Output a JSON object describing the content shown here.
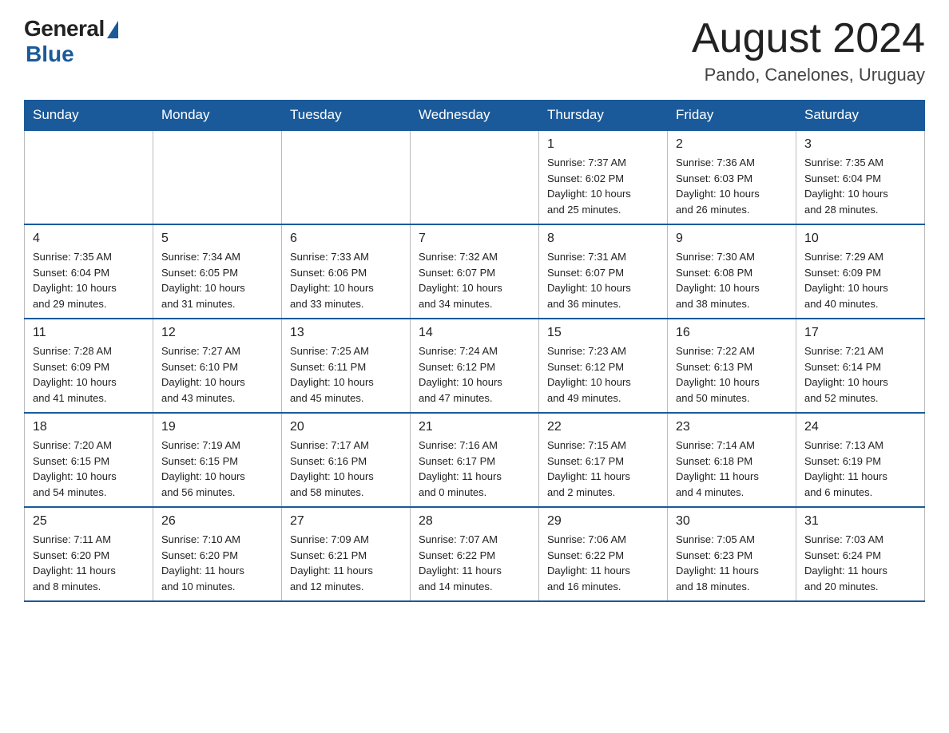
{
  "logo": {
    "general": "General",
    "blue": "Blue"
  },
  "header": {
    "title": "August 2024",
    "location": "Pando, Canelones, Uruguay"
  },
  "weekdays": [
    "Sunday",
    "Monday",
    "Tuesday",
    "Wednesday",
    "Thursday",
    "Friday",
    "Saturday"
  ],
  "weeks": [
    [
      {
        "day": "",
        "info": ""
      },
      {
        "day": "",
        "info": ""
      },
      {
        "day": "",
        "info": ""
      },
      {
        "day": "",
        "info": ""
      },
      {
        "day": "1",
        "info": "Sunrise: 7:37 AM\nSunset: 6:02 PM\nDaylight: 10 hours\nand 25 minutes."
      },
      {
        "day": "2",
        "info": "Sunrise: 7:36 AM\nSunset: 6:03 PM\nDaylight: 10 hours\nand 26 minutes."
      },
      {
        "day": "3",
        "info": "Sunrise: 7:35 AM\nSunset: 6:04 PM\nDaylight: 10 hours\nand 28 minutes."
      }
    ],
    [
      {
        "day": "4",
        "info": "Sunrise: 7:35 AM\nSunset: 6:04 PM\nDaylight: 10 hours\nand 29 minutes."
      },
      {
        "day": "5",
        "info": "Sunrise: 7:34 AM\nSunset: 6:05 PM\nDaylight: 10 hours\nand 31 minutes."
      },
      {
        "day": "6",
        "info": "Sunrise: 7:33 AM\nSunset: 6:06 PM\nDaylight: 10 hours\nand 33 minutes."
      },
      {
        "day": "7",
        "info": "Sunrise: 7:32 AM\nSunset: 6:07 PM\nDaylight: 10 hours\nand 34 minutes."
      },
      {
        "day": "8",
        "info": "Sunrise: 7:31 AM\nSunset: 6:07 PM\nDaylight: 10 hours\nand 36 minutes."
      },
      {
        "day": "9",
        "info": "Sunrise: 7:30 AM\nSunset: 6:08 PM\nDaylight: 10 hours\nand 38 minutes."
      },
      {
        "day": "10",
        "info": "Sunrise: 7:29 AM\nSunset: 6:09 PM\nDaylight: 10 hours\nand 40 minutes."
      }
    ],
    [
      {
        "day": "11",
        "info": "Sunrise: 7:28 AM\nSunset: 6:09 PM\nDaylight: 10 hours\nand 41 minutes."
      },
      {
        "day": "12",
        "info": "Sunrise: 7:27 AM\nSunset: 6:10 PM\nDaylight: 10 hours\nand 43 minutes."
      },
      {
        "day": "13",
        "info": "Sunrise: 7:25 AM\nSunset: 6:11 PM\nDaylight: 10 hours\nand 45 minutes."
      },
      {
        "day": "14",
        "info": "Sunrise: 7:24 AM\nSunset: 6:12 PM\nDaylight: 10 hours\nand 47 minutes."
      },
      {
        "day": "15",
        "info": "Sunrise: 7:23 AM\nSunset: 6:12 PM\nDaylight: 10 hours\nand 49 minutes."
      },
      {
        "day": "16",
        "info": "Sunrise: 7:22 AM\nSunset: 6:13 PM\nDaylight: 10 hours\nand 50 minutes."
      },
      {
        "day": "17",
        "info": "Sunrise: 7:21 AM\nSunset: 6:14 PM\nDaylight: 10 hours\nand 52 minutes."
      }
    ],
    [
      {
        "day": "18",
        "info": "Sunrise: 7:20 AM\nSunset: 6:15 PM\nDaylight: 10 hours\nand 54 minutes."
      },
      {
        "day": "19",
        "info": "Sunrise: 7:19 AM\nSunset: 6:15 PM\nDaylight: 10 hours\nand 56 minutes."
      },
      {
        "day": "20",
        "info": "Sunrise: 7:17 AM\nSunset: 6:16 PM\nDaylight: 10 hours\nand 58 minutes."
      },
      {
        "day": "21",
        "info": "Sunrise: 7:16 AM\nSunset: 6:17 PM\nDaylight: 11 hours\nand 0 minutes."
      },
      {
        "day": "22",
        "info": "Sunrise: 7:15 AM\nSunset: 6:17 PM\nDaylight: 11 hours\nand 2 minutes."
      },
      {
        "day": "23",
        "info": "Sunrise: 7:14 AM\nSunset: 6:18 PM\nDaylight: 11 hours\nand 4 minutes."
      },
      {
        "day": "24",
        "info": "Sunrise: 7:13 AM\nSunset: 6:19 PM\nDaylight: 11 hours\nand 6 minutes."
      }
    ],
    [
      {
        "day": "25",
        "info": "Sunrise: 7:11 AM\nSunset: 6:20 PM\nDaylight: 11 hours\nand 8 minutes."
      },
      {
        "day": "26",
        "info": "Sunrise: 7:10 AM\nSunset: 6:20 PM\nDaylight: 11 hours\nand 10 minutes."
      },
      {
        "day": "27",
        "info": "Sunrise: 7:09 AM\nSunset: 6:21 PM\nDaylight: 11 hours\nand 12 minutes."
      },
      {
        "day": "28",
        "info": "Sunrise: 7:07 AM\nSunset: 6:22 PM\nDaylight: 11 hours\nand 14 minutes."
      },
      {
        "day": "29",
        "info": "Sunrise: 7:06 AM\nSunset: 6:22 PM\nDaylight: 11 hours\nand 16 minutes."
      },
      {
        "day": "30",
        "info": "Sunrise: 7:05 AM\nSunset: 6:23 PM\nDaylight: 11 hours\nand 18 minutes."
      },
      {
        "day": "31",
        "info": "Sunrise: 7:03 AM\nSunset: 6:24 PM\nDaylight: 11 hours\nand 20 minutes."
      }
    ]
  ]
}
